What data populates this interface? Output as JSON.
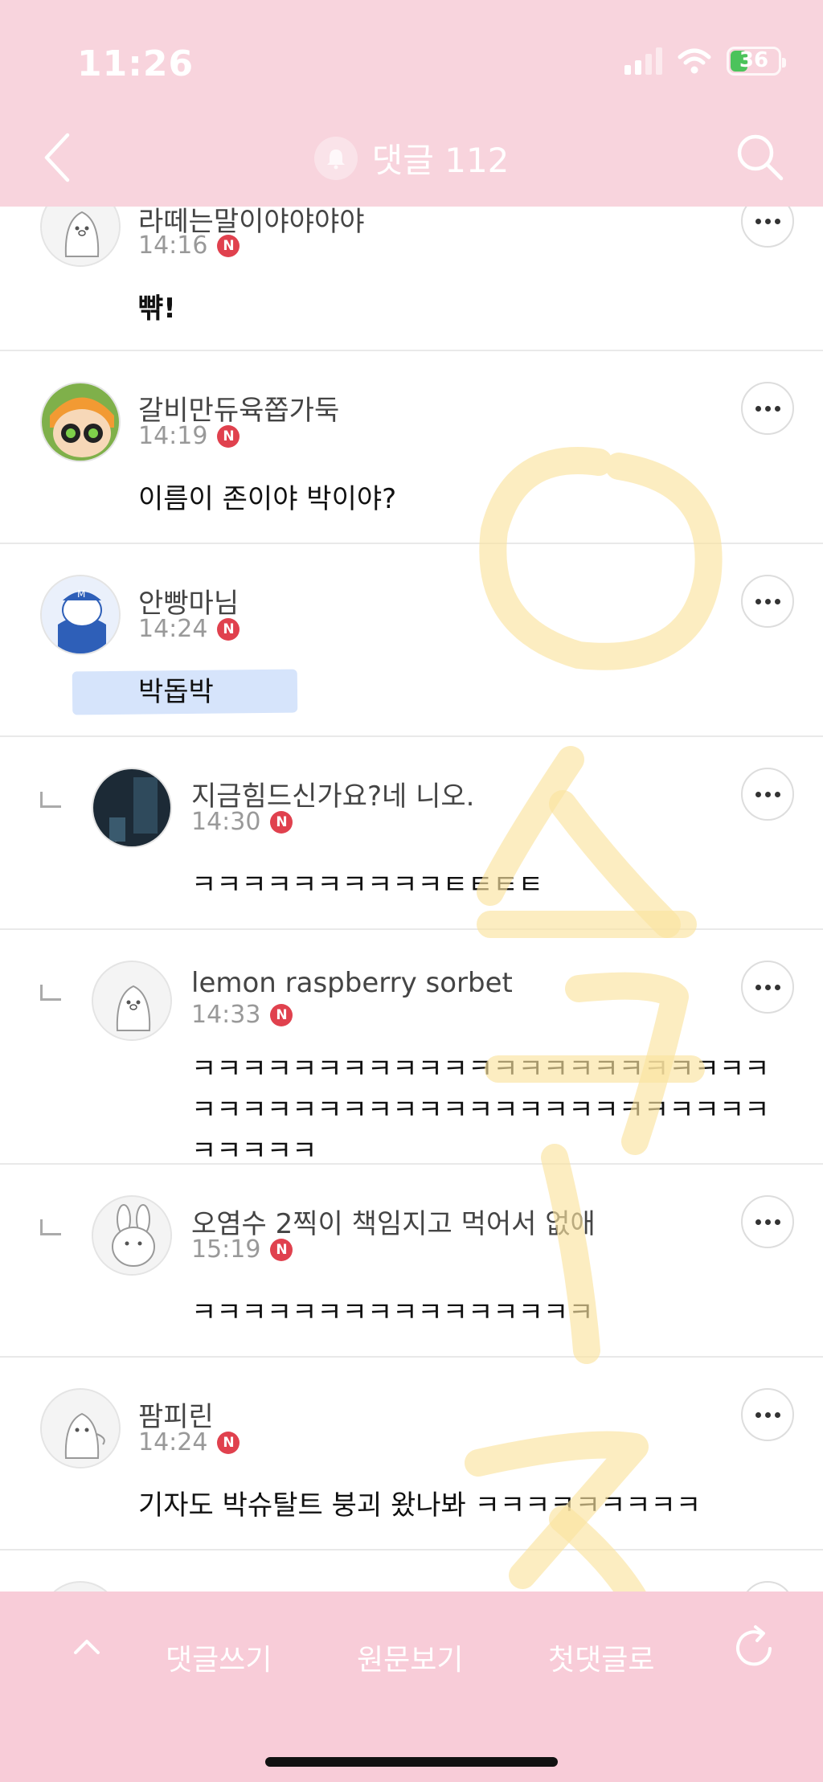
{
  "status": {
    "time": "11:26",
    "battery": "36"
  },
  "header": {
    "title": "댓글 112"
  },
  "comments": [
    {
      "nickname": "라떼는말이야야야야",
      "time": "14:16",
      "badge": "N",
      "text": "뺚!",
      "reply": false
    },
    {
      "nickname": "갈비만듀육쫍가둑",
      "time": "14:19",
      "badge": "N",
      "text": "이름이 존이야 박이야?",
      "reply": false
    },
    {
      "nickname": "안빵마님",
      "time": "14:24",
      "badge": "N",
      "text": "박돕박",
      "reply": false
    },
    {
      "nickname": "지금힘드신가요?네 니오.",
      "time": "14:30",
      "badge": "N",
      "text": "ㅋㅋㅋㅋㅋㅋㅋㅋㅋㅋㅌㅌㅌㅌ",
      "reply": true
    },
    {
      "nickname": "lemon raspberry sorbet",
      "time": "14:33",
      "badge": "N",
      "text": "ㅋㅋㅋㅋㅋㅋㅋㅋㅋㅋㅋㅋㅋㅋㅋㅋㅋㅋㅋㅋㅋㅋㅋㅋㅋㅋㅋㅋㅋㅋㅋㅋㅋㅋㅋㅋㅋㅋㅋㅋㅋㅋㅋㅋㅋㅋㅋㅋㅋㅋㅋ",
      "reply": true
    },
    {
      "nickname": "오염수 2찍이 책임지고 먹어서 없애",
      "time": "15:19",
      "badge": "N",
      "text": "ㅋㅋㅋㅋㅋㅋㅋㅋㅋㅋㅋㅋㅋㅋㅋㅋ",
      "reply": true
    },
    {
      "nickname": "팜피린",
      "time": "14:24",
      "badge": "N",
      "text": "기자도 박슈탈트 붕괴 왔나봐 ㅋㅋㅋㅋㅋㅋㅋㅋㅋ",
      "reply": false
    }
  ],
  "bottom_bar": {
    "write": "댓글쓰기",
    "original": "원문보기",
    "first": "첫댓글로"
  },
  "colors": {
    "header_bg": "#f8d4dd",
    "bottom_bg": "#f8ccd8",
    "badge": "#e0414e",
    "highlight": "#d6e4fb",
    "doodle": "#fbe6a6"
  },
  "icons": [
    "back-icon",
    "bell-icon",
    "search-icon",
    "more-icon",
    "chevron-up-icon",
    "refresh-icon",
    "signal-icon",
    "wifi-icon",
    "battery-icon"
  ]
}
